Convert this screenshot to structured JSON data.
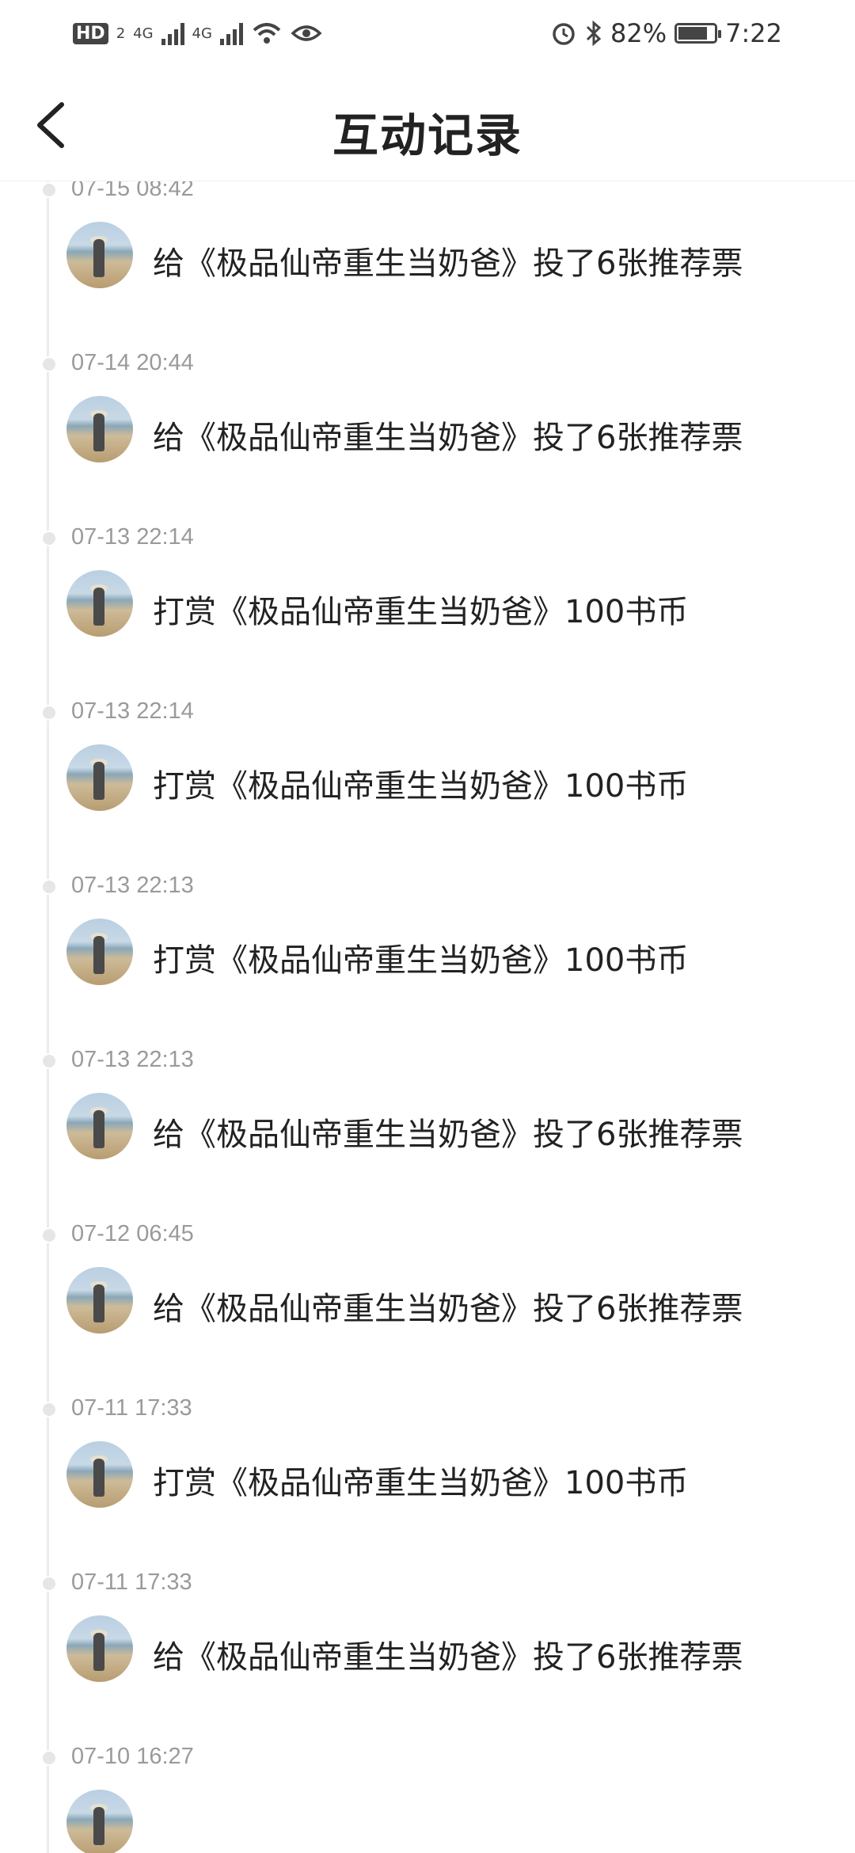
{
  "status_bar": {
    "left_badge": "HD",
    "left_badge_sub": "2",
    "net1": "4G",
    "net2": "4G",
    "battery_percent": "82%",
    "battery_level": 0.82,
    "time": "7:22"
  },
  "header": {
    "title": "互动记录"
  },
  "records": [
    {
      "time": "",
      "text": "打赏《极品仙帝重生当奶爸》100书币"
    },
    {
      "time": "07-15 08:42",
      "text": "给《极品仙帝重生当奶爸》投了6张推荐票"
    },
    {
      "time": "07-14 20:44",
      "text": "给《极品仙帝重生当奶爸》投了6张推荐票"
    },
    {
      "time": "07-13 22:14",
      "text": "打赏《极品仙帝重生当奶爸》100书币"
    },
    {
      "time": "07-13 22:14",
      "text": "打赏《极品仙帝重生当奶爸》100书币"
    },
    {
      "time": "07-13 22:13",
      "text": "打赏《极品仙帝重生当奶爸》100书币"
    },
    {
      "time": "07-13 22:13",
      "text": "给《极品仙帝重生当奶爸》投了6张推荐票"
    },
    {
      "time": "07-12 06:45",
      "text": "给《极品仙帝重生当奶爸》投了6张推荐票"
    },
    {
      "time": "07-11 17:33",
      "text": "打赏《极品仙帝重生当奶爸》100书币"
    },
    {
      "time": "07-11 17:33",
      "text": "给《极品仙帝重生当奶爸》投了6张推荐票"
    },
    {
      "time": "07-10 16:27",
      "text": ""
    }
  ]
}
